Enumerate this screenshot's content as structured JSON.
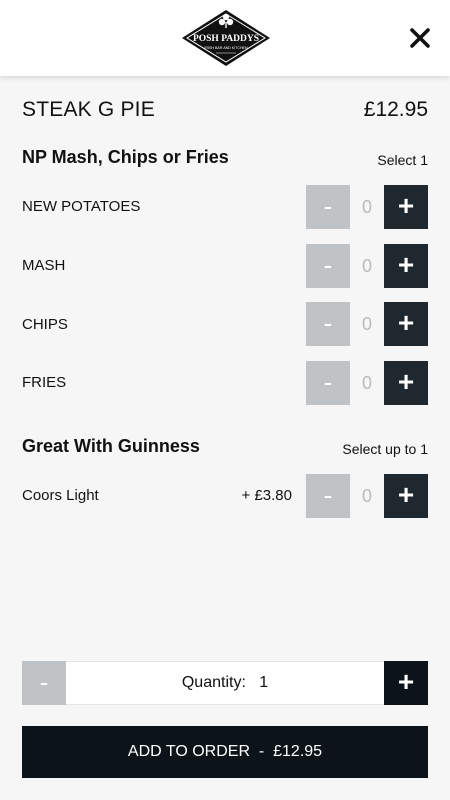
{
  "header": {
    "logo_text": "POSH PADDYS",
    "logo_subtext": "IRISH BAR AND KITCHEN",
    "close_icon": "close-icon"
  },
  "item": {
    "name": "STEAK G PIE",
    "price": "£12.95"
  },
  "groups": [
    {
      "title": "NP Mash, Chips or Fries",
      "rule": "Select 1",
      "options": [
        {
          "label": "NEW POTATOES",
          "count": "0",
          "minus": "-",
          "plus": "+"
        },
        {
          "label": "MASH",
          "count": "0",
          "minus": "-",
          "plus": "+"
        },
        {
          "label": "CHIPS",
          "count": "0",
          "minus": "-",
          "plus": "+"
        },
        {
          "label": "FRIES",
          "count": "0",
          "minus": "-",
          "plus": "+"
        }
      ]
    },
    {
      "title": "Great With Guinness",
      "rule": "Select up to 1",
      "options": [
        {
          "label": "Coors Light",
          "extra": "+ £3.80",
          "count": "0",
          "minus": "-",
          "plus": "+"
        }
      ]
    }
  ],
  "quantity": {
    "label": "Quantity:",
    "value": "1",
    "minus": "-",
    "plus": "+"
  },
  "order_button": {
    "label": "ADD TO ORDER",
    "separator": "-",
    "total": "£12.95"
  },
  "colors": {
    "accent": "#1e282e",
    "disabled": "#bfc3c6",
    "button_dark": "#0c1419"
  }
}
